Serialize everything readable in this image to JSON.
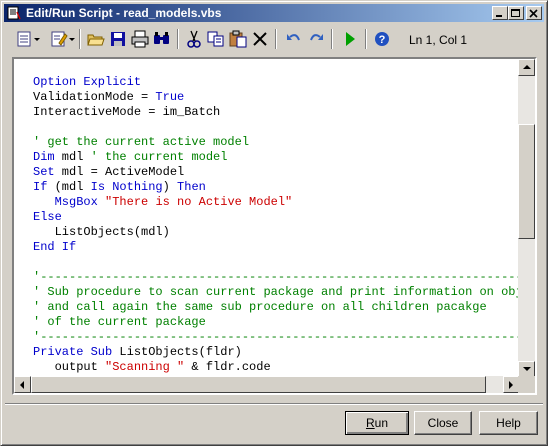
{
  "window": {
    "title": "Edit/Run Script - read_models.vbs"
  },
  "toolbar": {
    "cursor_position": "Ln 1, Col 1",
    "icons": [
      "edit-menu-icon",
      "properties-icon",
      "open-folder-icon",
      "save-icon",
      "print-icon",
      "find-icon",
      "cut-icon",
      "copy-icon",
      "paste-icon",
      "delete-icon",
      "undo-icon",
      "redo-icon",
      "run-icon",
      "help-icon"
    ]
  },
  "code": {
    "lines": [
      [
        [
          "kw",
          "Option Explicit"
        ]
      ],
      [
        [
          "id",
          "ValidationMode = "
        ],
        [
          "kw",
          "True"
        ]
      ],
      [
        [
          "id",
          "InteractiveMode = im_Batch"
        ]
      ],
      [],
      [
        [
          "cm",
          "' get the current active model"
        ]
      ],
      [
        [
          "kw",
          "Dim"
        ],
        [
          "id",
          " mdl "
        ],
        [
          "cm",
          "' the current model"
        ]
      ],
      [
        [
          "kw",
          "Set"
        ],
        [
          "id",
          " mdl = ActiveModel"
        ]
      ],
      [
        [
          "kw",
          "If"
        ],
        [
          "id",
          " (mdl "
        ],
        [
          "kw",
          "Is Nothing"
        ],
        [
          "id",
          ") "
        ],
        [
          "kw",
          "Then"
        ]
      ],
      [
        [
          "id",
          "   "
        ],
        [
          "kw",
          "MsgBox"
        ],
        [
          "id",
          " "
        ],
        [
          "st",
          "\"There is no Active Model\""
        ]
      ],
      [
        [
          "kw",
          "Else"
        ]
      ],
      [
        [
          "id",
          "   ListObjects(mdl)"
        ]
      ],
      [
        [
          "kw",
          "End If"
        ]
      ],
      [],
      [
        [
          "cm",
          "'-----------------------------------------------------------------------------"
        ]
      ],
      [
        [
          "cm",
          "' Sub procedure to scan current package and print information on objec"
        ]
      ],
      [
        [
          "cm",
          "' and call again the same sub procedure on all children pacakge"
        ]
      ],
      [
        [
          "cm",
          "' of the current package"
        ]
      ],
      [
        [
          "cm",
          "'-----------------------------------------------------------------------------"
        ]
      ],
      [
        [
          "kw",
          "Private Sub"
        ],
        [
          "id",
          " ListObjects(fldr)"
        ]
      ],
      [
        [
          "id",
          "   output "
        ],
        [
          "st",
          "\"Scanning \""
        ],
        [
          "id",
          " & fldr.code"
        ]
      ]
    ]
  },
  "buttons": {
    "run_prefix": "",
    "run_mnemonic": "R",
    "run_rest": "un",
    "close": "Close",
    "help": "Help"
  },
  "colors": {
    "keyword": "#0000cc",
    "comment": "#008000",
    "string": "#cc0000",
    "title_start": "#0a246a",
    "title_end": "#a6caf0"
  }
}
